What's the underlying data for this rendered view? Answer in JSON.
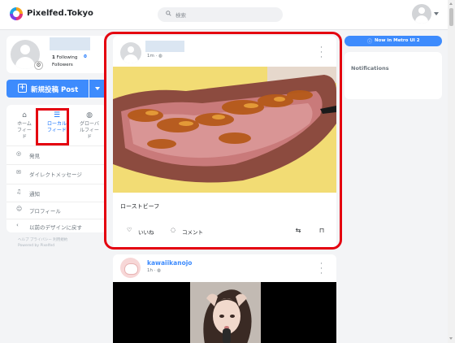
{
  "header": {
    "brand": "Pixelfed.Tokyo",
    "search_placeholder": "検索"
  },
  "profile": {
    "following_count": "1",
    "following_label": "Following",
    "followers_count": "0",
    "followers_label": "Followers"
  },
  "new_post": {
    "label": "新規投稿 Post"
  },
  "feeds": [
    {
      "label": "ホーム\nフィー\nド",
      "icon": "home-icon"
    },
    {
      "label": "ローカル\nフィード",
      "icon": "list-icon"
    },
    {
      "label": "グローバ\nルフィー\nド",
      "icon": "globe-icon"
    }
  ],
  "nav": [
    {
      "label": "発見",
      "icon": "compass-icon"
    },
    {
      "label": "ダイレクトメッセージ",
      "icon": "mail-icon"
    },
    {
      "label": "通知",
      "icon": "bell-icon"
    },
    {
      "label": "プロフィール",
      "icon": "user-icon"
    },
    {
      "label": "以前のデザインに戻す",
      "icon": "chevron-left-icon"
    }
  ],
  "footer_links": "ヘルプ プライバシー 利用規約\nPowered by Pixelfed",
  "post1": {
    "time": "1m",
    "caption": "ローストビーフ",
    "like_label": "いいね",
    "comment_label": "コメント"
  },
  "post2": {
    "username": "kawaiikanojo",
    "time": "1h"
  },
  "right": {
    "metro_label": "Now in Metro UI 2",
    "notifications_title": "Notifications"
  },
  "colors": {
    "accent": "#3d8bfd",
    "highlight": "#e4000f"
  }
}
